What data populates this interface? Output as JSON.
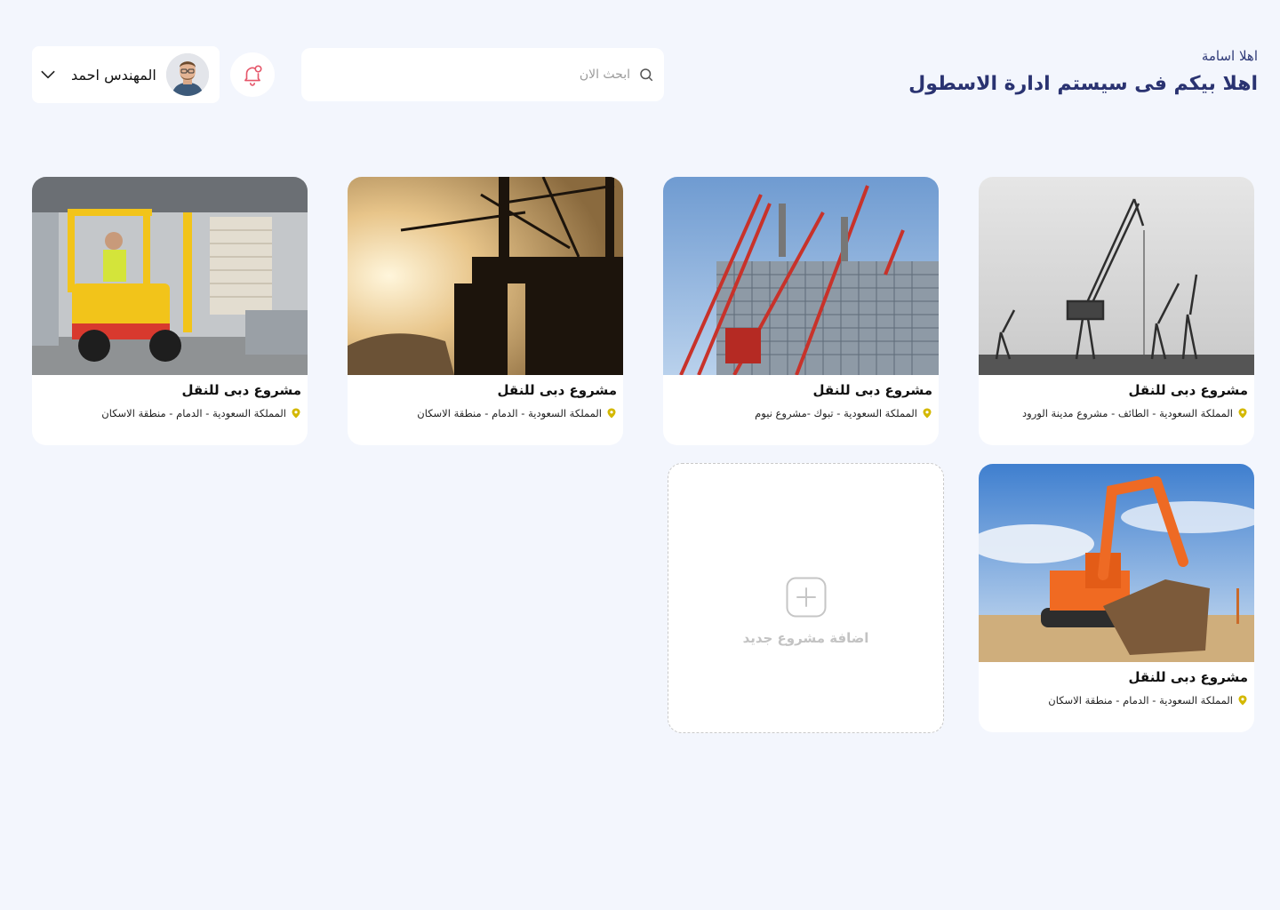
{
  "header": {
    "greeting_small": "اهلا اسامة",
    "greeting_title": "اهلا بيكم فى سيستم ادارة الاسطول",
    "search_placeholder": "ابحث الان",
    "user_name": "المهندس احمد"
  },
  "projects": [
    {
      "title": "مشروع دبى للنقل",
      "location": "المملكة السعودية - الطائف - مشروع مدينة الورود",
      "image": "port-cranes-bw"
    },
    {
      "title": "مشروع دبى للنقل",
      "location": "المملكة السعودية - تبوك -مشروع نيوم",
      "image": "construction-cranes"
    },
    {
      "title": "مشروع دبى للنقل",
      "location": "المملكة السعودية - الدمام - منطقة الاسكان",
      "image": "oil-rig-sunset"
    },
    {
      "title": "مشروع دبى للنقل",
      "location": "المملكة السعودية - الدمام - منطقة الاسكان",
      "image": "forklift-warehouse"
    },
    {
      "title": "مشروع دبى للنقل",
      "location": "المملكة السعودية - الدمام - منطقة الاسكان",
      "image": "excavator"
    }
  ],
  "add_project_label": "اضافة مشروع جديد",
  "colors": {
    "background": "#f3f6fd",
    "title": "#2a3371",
    "pin": "#d4b800",
    "bell": "#e5566a"
  }
}
